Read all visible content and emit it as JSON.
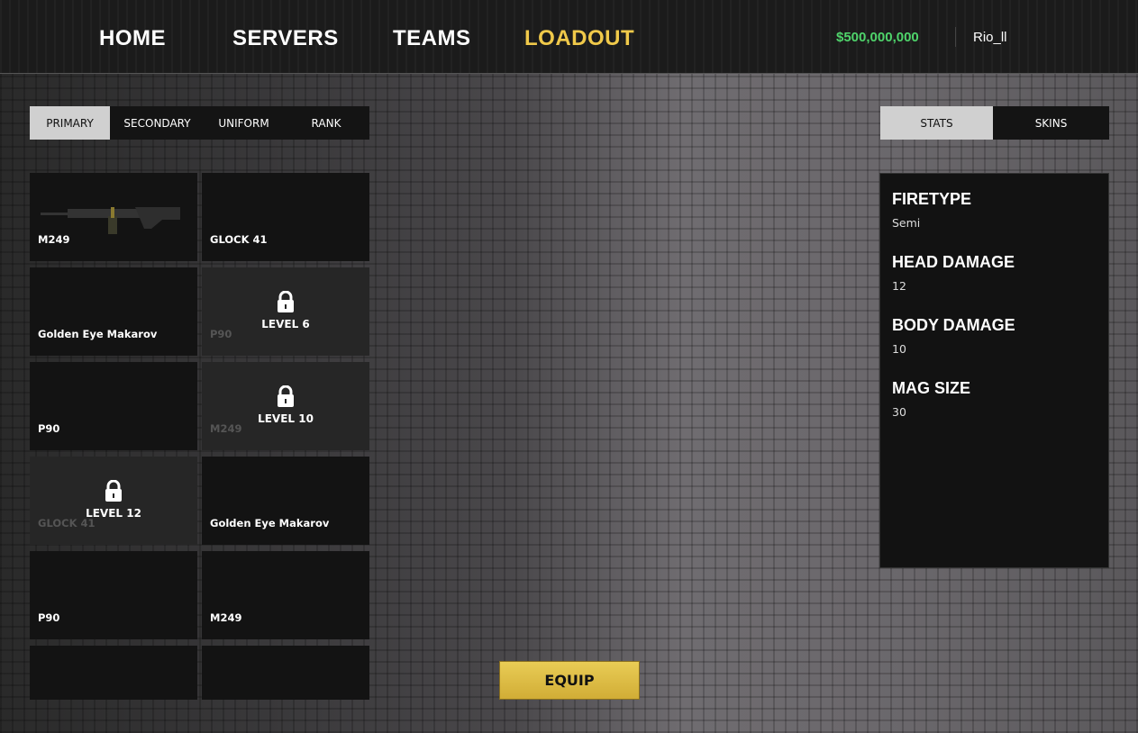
{
  "nav": {
    "items": [
      "HOME",
      "SERVERS",
      "TEAMS",
      "LOADOUT"
    ],
    "active": "LOADOUT",
    "active_color": "#f0c94a"
  },
  "account": {
    "money": "$500,000,000",
    "username": "Rio_ll"
  },
  "category_tabs": [
    "PRIMARY",
    "SECONDARY",
    "UNIFORM",
    "RANK"
  ],
  "panel_tabs": [
    "STATS",
    "SKINS"
  ],
  "weapons": [
    {
      "name": "M249",
      "locked": false
    },
    {
      "name": "GLOCK 41",
      "locked": false
    },
    {
      "name": "Golden Eye Makarov",
      "locked": false
    },
    {
      "name": "P90",
      "locked": true,
      "lock_label": "LEVEL 6"
    },
    {
      "name": "P90",
      "locked": false
    },
    {
      "name": "M249",
      "locked": true,
      "lock_label": "LEVEL 10"
    },
    {
      "name": "GLOCK 41",
      "locked": true,
      "lock_label": "LEVEL 12"
    },
    {
      "name": "Golden Eye Makarov",
      "locked": false
    },
    {
      "name": "P90",
      "locked": false
    },
    {
      "name": "M249",
      "locked": false
    },
    {
      "name": "",
      "locked": false
    },
    {
      "name": "",
      "locked": false
    }
  ],
  "stats": [
    {
      "label": "FIRETYPE",
      "value": "Semi"
    },
    {
      "label": "HEAD DAMAGE",
      "value": "12"
    },
    {
      "label": "BODY DAMAGE",
      "value": "10"
    },
    {
      "label": "MAG SIZE",
      "value": "30"
    }
  ],
  "equip_label": "EQUIP"
}
